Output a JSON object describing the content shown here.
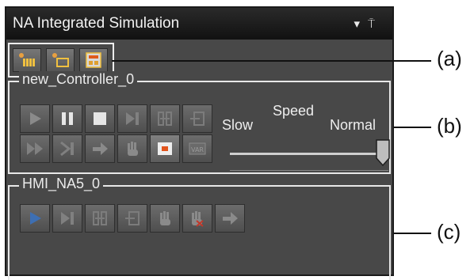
{
  "window": {
    "title": "NA Integrated Simulation",
    "dropdown_icon": "▾",
    "pin_icon": "⍑"
  },
  "toolbar": {
    "items": [
      "controller-setup-icon",
      "hmi-setup-icon",
      "simulation-settings-icon"
    ]
  },
  "controller": {
    "name": "new_Controller_0",
    "speed_label": "Speed",
    "slow_label": "Slow",
    "normal_label": "Normal",
    "speed_value": 1.0
  },
  "hmi": {
    "name": "HMI_NA5_0"
  },
  "callouts": {
    "a": "(a)",
    "b": "(b)",
    "c": "(c)"
  }
}
